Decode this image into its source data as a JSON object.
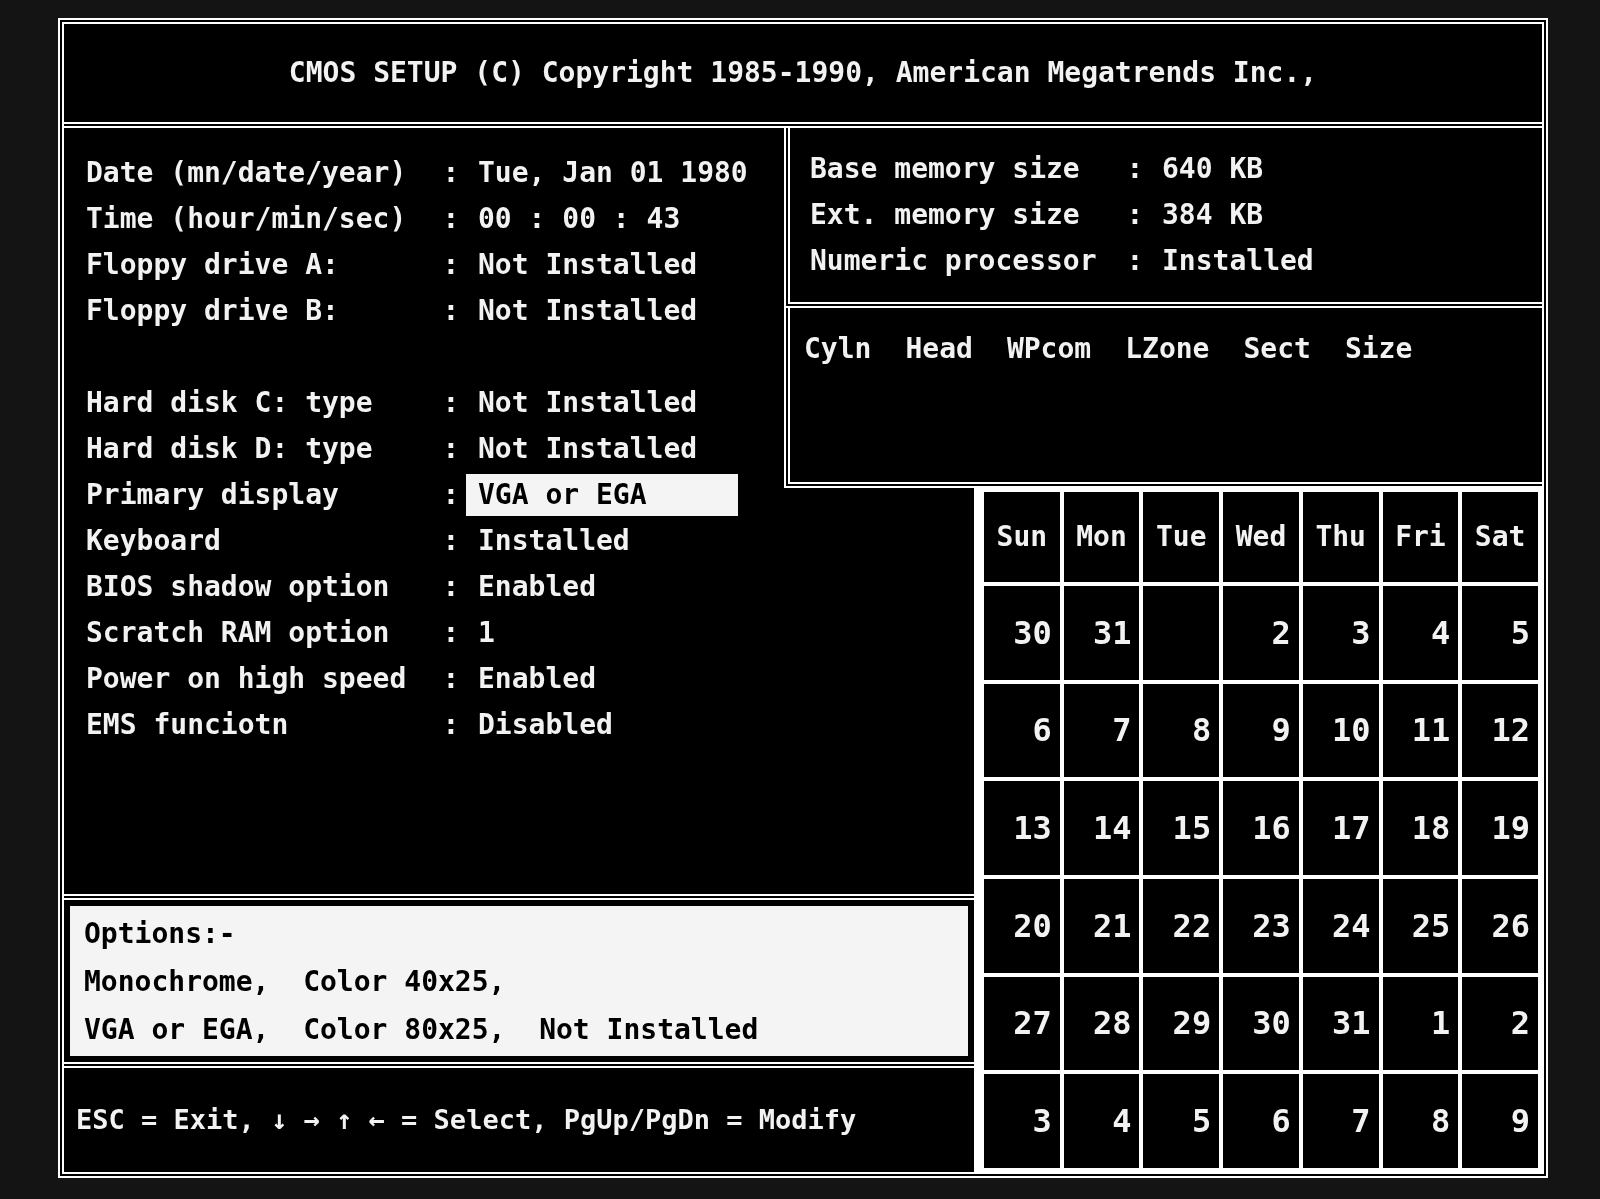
{
  "title": "CMOS SETUP (C) Copyright 1985-1990, American Megatrends Inc.,",
  "setting_groups": [
    [
      {
        "label": "Date (mn/date/year)",
        "sep": ":",
        "value": "Tue, Jan 01 1980",
        "selected": false
      },
      {
        "label": "Time (hour/min/sec)",
        "sep": ":",
        "value": "00 : 00 : 43",
        "selected": false
      },
      {
        "label": "Floppy drive A:",
        "sep": ":",
        "value": "Not Installed",
        "selected": false
      },
      {
        "label": "Floppy drive B:",
        "sep": ":",
        "value": "Not Installed",
        "selected": false
      }
    ],
    [
      {
        "label": "Hard disk C: type",
        "sep": ":",
        "value": "Not Installed",
        "selected": false
      },
      {
        "label": "Hard disk D: type",
        "sep": ":",
        "value": "Not Installed",
        "selected": false
      },
      {
        "label": "Primary display",
        "sep": ":",
        "value": "VGA or EGA",
        "selected": true
      },
      {
        "label": "Keyboard",
        "sep": ":",
        "value": "Installed",
        "selected": false
      },
      {
        "label": "BIOS shadow option",
        "sep": ":",
        "value": "Enabled",
        "selected": false
      },
      {
        "label": "Scratch RAM option",
        "sep": ":",
        "value": "1",
        "selected": false
      },
      {
        "label": "Power on high speed",
        "sep": ":",
        "value": "Enabled",
        "selected": false
      },
      {
        "label": "EMS funciotn",
        "sep": ":",
        "value": "Disabled",
        "selected": false
      }
    ]
  ],
  "memory": [
    {
      "label": "Base memory size",
      "sep": ":",
      "value": "640 KB"
    },
    {
      "label": "Ext. memory size",
      "sep": ":",
      "value": "384 KB"
    },
    {
      "label": "Numeric processor",
      "sep": ":",
      "value": "Installed"
    }
  ],
  "disk_columns": [
    "Cyln",
    "Head",
    "WPcom",
    "LZone",
    "Sect",
    "Size"
  ],
  "calendar": {
    "weekdays": [
      "Sun",
      "Mon",
      "Tue",
      "Wed",
      "Thu",
      "Fri",
      "Sat"
    ],
    "weeks": [
      [
        {
          "kind": "day",
          "text": "30"
        },
        {
          "kind": "day",
          "text": "31"
        },
        {
          "kind": "blank"
        },
        {
          "kind": "day",
          "text": "2"
        },
        {
          "kind": "day",
          "text": "3"
        },
        {
          "kind": "day",
          "text": "4"
        },
        {
          "kind": "day",
          "text": "5"
        }
      ],
      [
        {
          "kind": "day",
          "text": "6"
        },
        {
          "kind": "day",
          "text": "7"
        },
        {
          "kind": "day",
          "text": "8"
        },
        {
          "kind": "day",
          "text": "9"
        },
        {
          "kind": "day",
          "text": "10"
        },
        {
          "kind": "day",
          "text": "11"
        },
        {
          "kind": "day",
          "text": "12"
        }
      ],
      [
        {
          "kind": "day",
          "text": "13"
        },
        {
          "kind": "day",
          "text": "14"
        },
        {
          "kind": "day",
          "text": "15"
        },
        {
          "kind": "day",
          "text": "16"
        },
        {
          "kind": "day",
          "text": "17"
        },
        {
          "kind": "day",
          "text": "18"
        },
        {
          "kind": "day",
          "text": "19"
        }
      ],
      [
        {
          "kind": "day",
          "text": "20"
        },
        {
          "kind": "day",
          "text": "21"
        },
        {
          "kind": "day",
          "text": "22"
        },
        {
          "kind": "day",
          "text": "23"
        },
        {
          "kind": "day",
          "text": "24"
        },
        {
          "kind": "day",
          "text": "25"
        },
        {
          "kind": "day",
          "text": "26"
        }
      ],
      [
        {
          "kind": "day",
          "text": "27"
        },
        {
          "kind": "day",
          "text": "28"
        },
        {
          "kind": "day",
          "text": "29"
        },
        {
          "kind": "day",
          "text": "30"
        },
        {
          "kind": "day",
          "text": "31"
        },
        {
          "kind": "day",
          "text": "1"
        },
        {
          "kind": "day",
          "text": "2"
        }
      ],
      [
        {
          "kind": "day",
          "text": "3"
        },
        {
          "kind": "day",
          "text": "4"
        },
        {
          "kind": "day",
          "text": "5"
        },
        {
          "kind": "day",
          "text": "6"
        },
        {
          "kind": "day",
          "text": "7"
        },
        {
          "kind": "day",
          "text": "8"
        },
        {
          "kind": "day",
          "text": "9"
        }
      ]
    ]
  },
  "options": [
    "Options:-",
    "Monochrome,  Color 40x25,",
    "VGA or EGA,  Color 80x25,  Not Installed"
  ],
  "help": "ESC = Exit, ↓ → ↑ ← = Select, PgUp/PgDn = Modify"
}
